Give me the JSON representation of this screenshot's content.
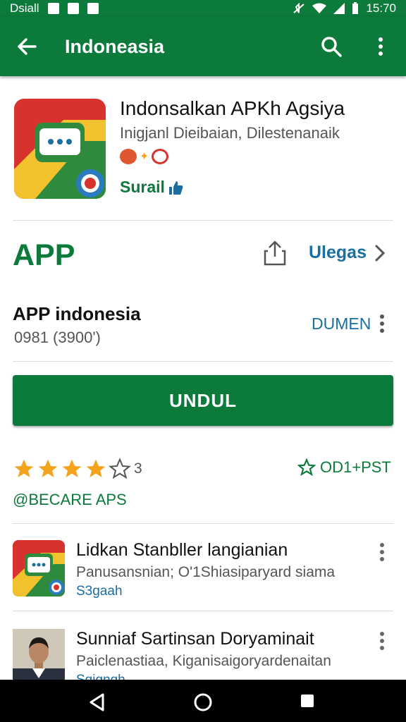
{
  "status_bar": {
    "carrier": "Dsiall",
    "time": "15:70"
  },
  "app_bar": {
    "title": "Indoneasia",
    "icons": [
      "back-arrow-icon",
      "search-icon",
      "more-vert-icon"
    ]
  },
  "app": {
    "title": "Indonsalkan APKh Agsiya",
    "developer_line": "Inigjanl Dieibaian, Dilestenanaik",
    "tag": "Surail",
    "label": "APP",
    "update_label": "Ulegas",
    "dev_name": "APP indonesia",
    "dev_number": "0981 (3900')",
    "dev_action": "DUMEN",
    "install_label": "UNDUL",
    "rating_value": 4,
    "rating_max": 5,
    "rating_count": "3",
    "wishlist_label": "OD1+PST",
    "section_label": "@BECARE APS"
  },
  "list": [
    {
      "title": "Lidkan Stanbller langianian",
      "subtitle": "Panusansnian; O'1Shiasiparyard siama",
      "tag": "S3gaah"
    },
    {
      "title": "Sunniaf Sartinsan Doryaminait",
      "subtitle": "Paiclenastiaa, Kiganisaigoryardenaitan",
      "tag": "Sgigngh"
    }
  ],
  "colors": {
    "primary": "#0b7a3b",
    "link": "#1a6ea0",
    "star": "#f5a21c",
    "navbar": "#000000"
  }
}
